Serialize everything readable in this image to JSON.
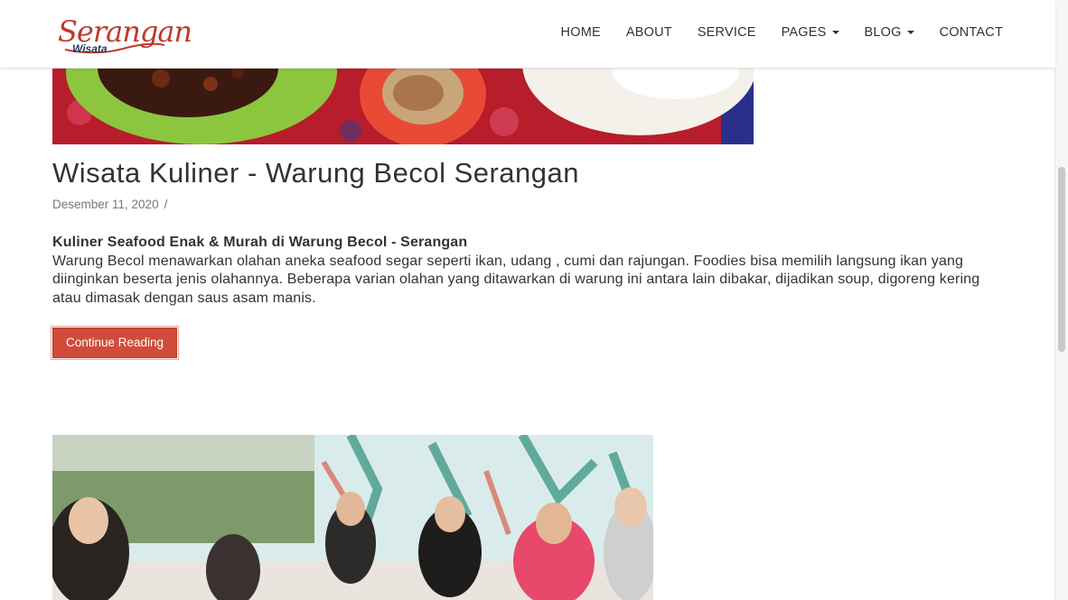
{
  "brand": {
    "logo_script": "Serangan",
    "logo_sub": "Wisata"
  },
  "nav": {
    "home": "HOME",
    "about": "ABOUT",
    "service": "SERVICE",
    "pages": "PAGES",
    "blog": "BLOG",
    "contact": "CONTACT"
  },
  "post": {
    "title": "Wisata Kuliner - Warung Becol Serangan",
    "date": "Desember 11, 2020",
    "date_sep": "/",
    "lead": "Kuliner Seafood Enak & Murah di Warung Becol - Serangan",
    "body": "Warung Becol menawarkan olahan aneka seafood segar seperti ikan, udang , cumi dan rajungan. Foodies bisa memilih langsung ikan yang diinginkan beserta jenis olahannya. Beberapa varian olahan yang ditawarkan di warung ini antara lain dibakar, dijadikan soup, digoreng kering atau dimasak dengan saus asam manis.",
    "continue_label": "Continue Reading"
  },
  "colors": {
    "accent": "#d14b3a",
    "logo_red": "#c0392b",
    "logo_blue": "#1f3a5c"
  }
}
